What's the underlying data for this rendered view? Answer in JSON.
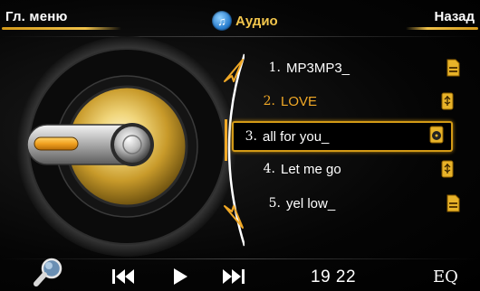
{
  "header": {
    "menu_label": "Гл. меню",
    "title": "Аудио",
    "back_label": "Назад"
  },
  "playlist": [
    {
      "number": "1.",
      "name": "MP3MP3_",
      "icon": "memory-card-icon",
      "state": "normal"
    },
    {
      "number": "2.",
      "name": "LOVE",
      "icon": "usb-icon",
      "state": "playing"
    },
    {
      "number": "3.",
      "name": "all for you_",
      "icon": "disc-icon",
      "state": "selected"
    },
    {
      "number": "4.",
      "name": "Let me go",
      "icon": "usb-icon",
      "state": "normal"
    },
    {
      "number": "5.",
      "name": "yel low_",
      "icon": "memory-card-icon",
      "state": "normal"
    }
  ],
  "controls": {
    "time": "19 22",
    "eq_label": "EQ"
  },
  "colors": {
    "accent": "#f1b32a",
    "selected_border": "#d39a16",
    "title_icon": "#2a7fd0"
  }
}
